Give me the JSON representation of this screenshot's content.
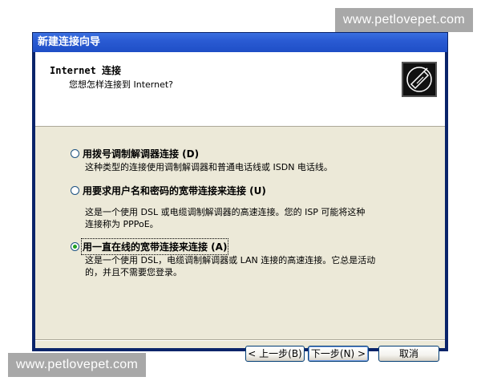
{
  "watermark": {
    "top": "www.petlovepet.com",
    "bottom": "www.petlovepet.com"
  },
  "window": {
    "title": "新建连接向导"
  },
  "header": {
    "title": "Internet 连接",
    "subtitle": "您想怎样连接到 Internet?",
    "icon": "internet-connection-icon"
  },
  "options": [
    {
      "label": "用拨号调制解调器连接 (D)",
      "selected": false,
      "description": "这种类型的连接使用调制解调器和普通电话线或 ISDN 电话线。"
    },
    {
      "label": "用要求用户名和密码的宽带连接来连接 (U)",
      "selected": false,
      "description": "这是一个使用 DSL 或电缆调制解调器的高速连接。您的 ISP 可能将这种\n连接称为 PPPoE。"
    },
    {
      "label": "用一直在线的宽带连接来连接 (A)",
      "selected": true,
      "description": "这是一个使用 DSL，电缆调制解调器或 LAN 连接的高速连接。它总是活动\n的，并且不需要您登录。"
    }
  ],
  "buttons": {
    "back": "< 上一步(B)",
    "next": "下一步(N) >",
    "cancel": "取消"
  },
  "colors": {
    "titlebar": "#2a5bd3",
    "dialog": "#ece9d8",
    "radio_selected": "#21a121"
  }
}
